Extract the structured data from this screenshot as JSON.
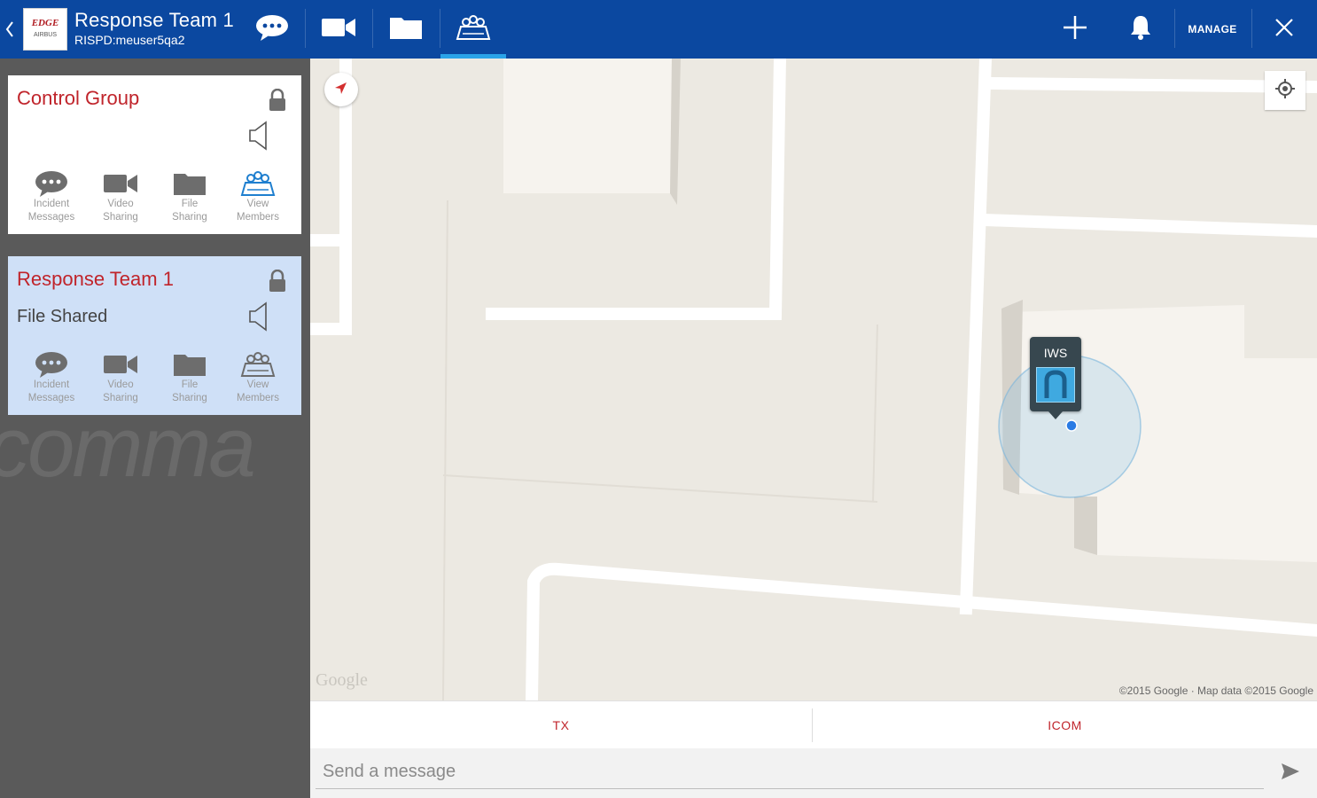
{
  "header": {
    "logo_text": "EDGE",
    "logo_sub": "AIRBUS",
    "title": "Response Team 1",
    "subtitle": "RISPD:meuser5qa2",
    "tabs": [
      {
        "name": "incident-messages",
        "icon": "chat-bubble-icon"
      },
      {
        "name": "video-sharing",
        "icon": "video-camera-icon"
      },
      {
        "name": "file-sharing",
        "icon": "folder-icon"
      },
      {
        "name": "view-members",
        "icon": "members-map-icon",
        "active": true
      }
    ],
    "manage_label": "MANAGE",
    "accent_color": "#0b48a0",
    "active_tab_color": "#2aa3e8"
  },
  "sidebar": {
    "watermark": "comma",
    "cards": [
      {
        "title": "Control Group",
        "status": "",
        "selected": false,
        "actions": [
          {
            "line1": "Incident",
            "line2": "Messages"
          },
          {
            "line1": "Video",
            "line2": "Sharing"
          },
          {
            "line1": "File",
            "line2": "Sharing"
          },
          {
            "line1": "View",
            "line2": "Members"
          }
        ]
      },
      {
        "title": "Response Team 1",
        "status": "File Shared",
        "selected": true,
        "actions": [
          {
            "line1": "Incident",
            "line2": "Messages"
          },
          {
            "line1": "Video",
            "line2": "Sharing"
          },
          {
            "line1": "File",
            "line2": "Sharing"
          },
          {
            "line1": "View",
            "line2": "Members"
          }
        ]
      }
    ]
  },
  "map": {
    "marker_label": "IWS",
    "google_logo": "Google",
    "attribution": "©2015 Google · Map data ©2015 Google"
  },
  "ptt": {
    "tx_label": "TX",
    "icom_label": "ICOM"
  },
  "message": {
    "placeholder": "Send a message"
  }
}
